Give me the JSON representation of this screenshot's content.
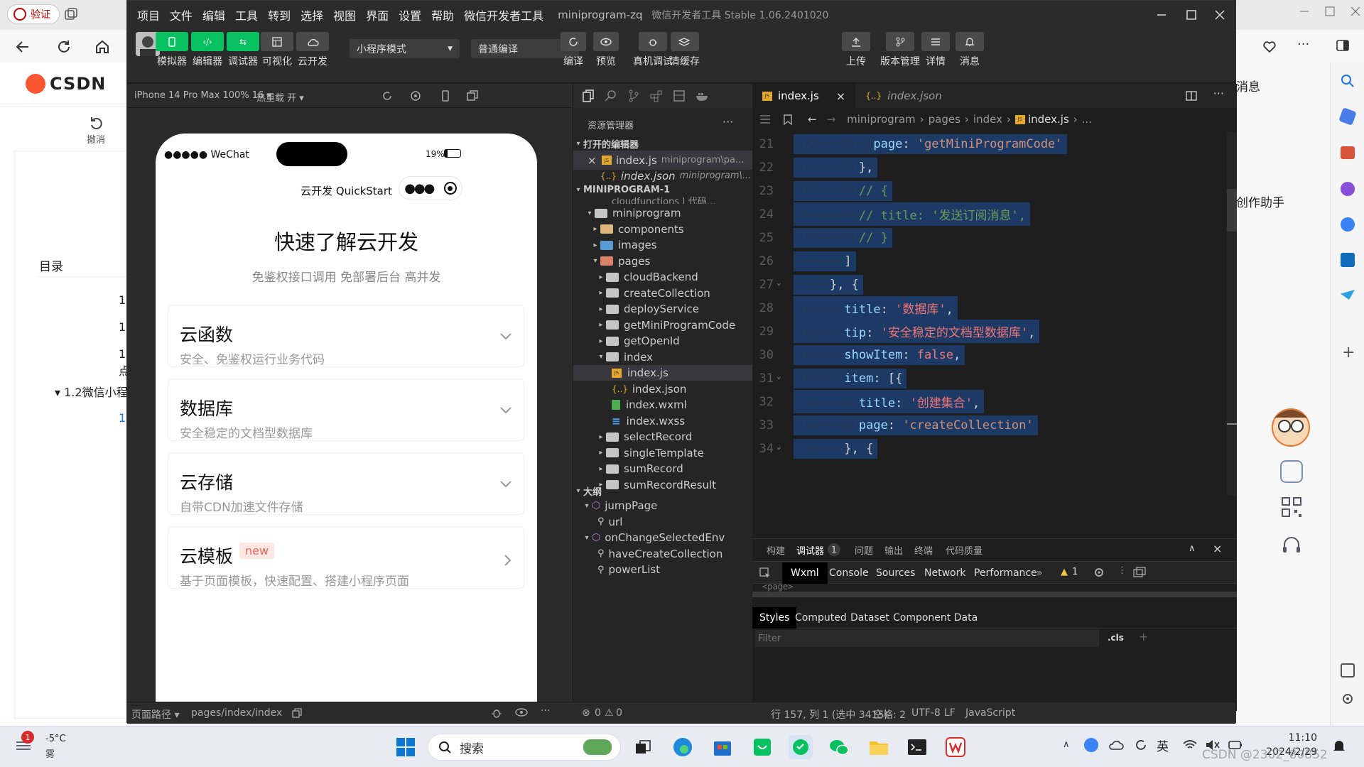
{
  "browser": {
    "verify_chip": "验证",
    "csdn_logo": "CSDN",
    "undo_label": "撤消",
    "toc_title": "目录",
    "toc_items": [
      "1.",
      "1.",
      "1.",
      "点",
      "▾ 1.2微信小程",
      "1."
    ],
    "right_labels": {
      "message": "消息",
      "assistant": "创作助手"
    },
    "colors": {
      "csdn_red": "#fc5531"
    }
  },
  "devtools": {
    "menu": [
      "项目",
      "文件",
      "编辑",
      "工具",
      "转到",
      "选择",
      "视图",
      "界面",
      "设置",
      "帮助",
      "微信开发者工具"
    ],
    "window_project": "miniprogram-zq",
    "window_title": "微信开发者工具 Stable 1.06.2401020",
    "toolbar": {
      "left_buttons": [
        "模拟器",
        "编辑器",
        "调试器",
        "可视化",
        "云开发"
      ],
      "mode_select": "小程序模式",
      "compile_select": "普通编译",
      "mid_buttons": [
        "编译",
        "预览",
        "真机调试",
        "清缓存"
      ],
      "right_buttons": [
        "上传",
        "版本管理",
        "详情",
        "消息"
      ]
    },
    "simulator": {
      "device": "iPhone 14 Pro Max 100% 16 ▾",
      "hot_reload": "热重载 开 ▾",
      "status_carrier": "●●●●● WeChat",
      "battery": "19%",
      "nav_title": "云开发 QuickStart",
      "hero_title": "快速了解云开发",
      "hero_sub": "免鉴权接口调用 免部署后台 高并发",
      "cards": [
        {
          "title": "云函数",
          "sub": "安全、免鉴权运行业务代码"
        },
        {
          "title": "数据库",
          "sub": "安全稳定的文档型数据库"
        },
        {
          "title": "云存储",
          "sub": "自带CDN加速文件存储"
        },
        {
          "title": "云模板",
          "badge": "new",
          "sub": "基于页面模板，快速配置、搭建小程序页面"
        }
      ],
      "status_path_label": "页面路径 ▾",
      "status_path": "pages/index/index"
    },
    "explorer": {
      "title": "资源管理器",
      "open_editors": "打开的编辑器",
      "open_files": [
        {
          "name": "index.js",
          "path": "miniprogram\\pa..."
        },
        {
          "name": "index.json",
          "path": "miniprogram\\..."
        }
      ],
      "project": "MINIPROGRAM-1",
      "cut_row": "cloudfunctions | 代码…",
      "tree": [
        {
          "label": "miniprogram",
          "depth": 1,
          "open": true,
          "kind": "folder"
        },
        {
          "label": "components",
          "depth": 2,
          "open": false,
          "kind": "folder-y"
        },
        {
          "label": "images",
          "depth": 2,
          "open": false,
          "kind": "folder-c"
        },
        {
          "label": "pages",
          "depth": 2,
          "open": true,
          "kind": "folder-p"
        },
        {
          "label": "cloudBackend",
          "depth": 3,
          "open": false,
          "kind": "folder"
        },
        {
          "label": "createCollection",
          "depth": 3,
          "open": false,
          "kind": "folder"
        },
        {
          "label": "deployService",
          "depth": 3,
          "open": false,
          "kind": "folder"
        },
        {
          "label": "getMiniProgramCode",
          "depth": 3,
          "open": false,
          "kind": "folder"
        },
        {
          "label": "getOpenId",
          "depth": 3,
          "open": false,
          "kind": "folder"
        },
        {
          "label": "index",
          "depth": 3,
          "open": true,
          "kind": "folder"
        },
        {
          "label": "index.js",
          "depth": 4,
          "kind": "js",
          "selected": true
        },
        {
          "label": "index.json",
          "depth": 4,
          "kind": "json"
        },
        {
          "label": "index.wxml",
          "depth": 4,
          "kind": "wxml"
        },
        {
          "label": "index.wxss",
          "depth": 4,
          "kind": "wxss"
        },
        {
          "label": "selectRecord",
          "depth": 3,
          "open": false,
          "kind": "folder"
        },
        {
          "label": "singleTemplate",
          "depth": 3,
          "open": false,
          "kind": "folder"
        },
        {
          "label": "sumRecord",
          "depth": 3,
          "open": false,
          "kind": "folder"
        },
        {
          "label": "sumRecordResult",
          "depth": 3,
          "open": false,
          "kind": "folder"
        }
      ],
      "outline_title": "大纲",
      "outline": [
        {
          "label": "jumpPage",
          "depth": 1,
          "kind": "cube"
        },
        {
          "label": "url",
          "depth": 2,
          "kind": "wrench"
        },
        {
          "label": "onChangeSelectedEnv",
          "depth": 1,
          "kind": "cube"
        },
        {
          "label": "haveCreateCollection",
          "depth": 2,
          "kind": "wrench"
        },
        {
          "label": "powerList",
          "depth": 2,
          "kind": "wrench"
        }
      ]
    },
    "editor": {
      "tabs": [
        {
          "label": "index.js",
          "active": true
        },
        {
          "label": "index.json",
          "active": false
        }
      ],
      "breadcrumb": [
        "miniprogram",
        "pages",
        "index",
        "index.js",
        "..."
      ],
      "lines": [
        {
          "n": "21",
          "text": "page: 'getMiniProgramCode'"
        },
        {
          "n": "22",
          "text": "},"
        },
        {
          "n": "23",
          "text": "// {"
        },
        {
          "n": "24",
          "text": "//   title: '发送订阅消息',"
        },
        {
          "n": "25",
          "text": "// }"
        },
        {
          "n": "26",
          "text": "]"
        },
        {
          "n": "27",
          "text": "}, {"
        },
        {
          "n": "28",
          "text": "title: '数据库',"
        },
        {
          "n": "29",
          "text": "tip: '安全稳定的文档型数据库',"
        },
        {
          "n": "30",
          "text": "showItem: false,"
        },
        {
          "n": "31",
          "text": "item: [{"
        },
        {
          "n": "32",
          "text": "title: '创建集合',"
        },
        {
          "n": "33",
          "text": "page: 'createCollection'"
        },
        {
          "n": "34",
          "text": "}, {"
        }
      ]
    },
    "debugger": {
      "tabs": [
        "构建",
        "调试器",
        "问题",
        "输出",
        "终端",
        "代码质量"
      ],
      "active_tab": "调试器",
      "debugger_badge": "1",
      "subtabs": [
        "Wxml",
        "Console",
        "Sources",
        "Network",
        "Performance"
      ],
      "active_subtab": "Wxml",
      "warn_count": "1",
      "cut_text": "<page>",
      "style_tabs": [
        "Styles",
        "Computed",
        "Dataset",
        "Component Data"
      ],
      "filter_placeholder": "Filter",
      "cls": ".cls"
    },
    "status": {
      "errors": "0",
      "warnings": "0",
      "position": "行 157, 列 1 (选中 3415)",
      "spaces": "空格: 2",
      "encoding": "UTF-8",
      "eol": "LF",
      "language": "JavaScript"
    }
  },
  "taskbar": {
    "weather_temp": "-5°C",
    "weather_desc": "雾",
    "weather_badge": "1",
    "search": "搜索",
    "time": "11:10",
    "date": "2024/2/29",
    "ime": "英",
    "watermark": "CSDN @2302_80852"
  }
}
